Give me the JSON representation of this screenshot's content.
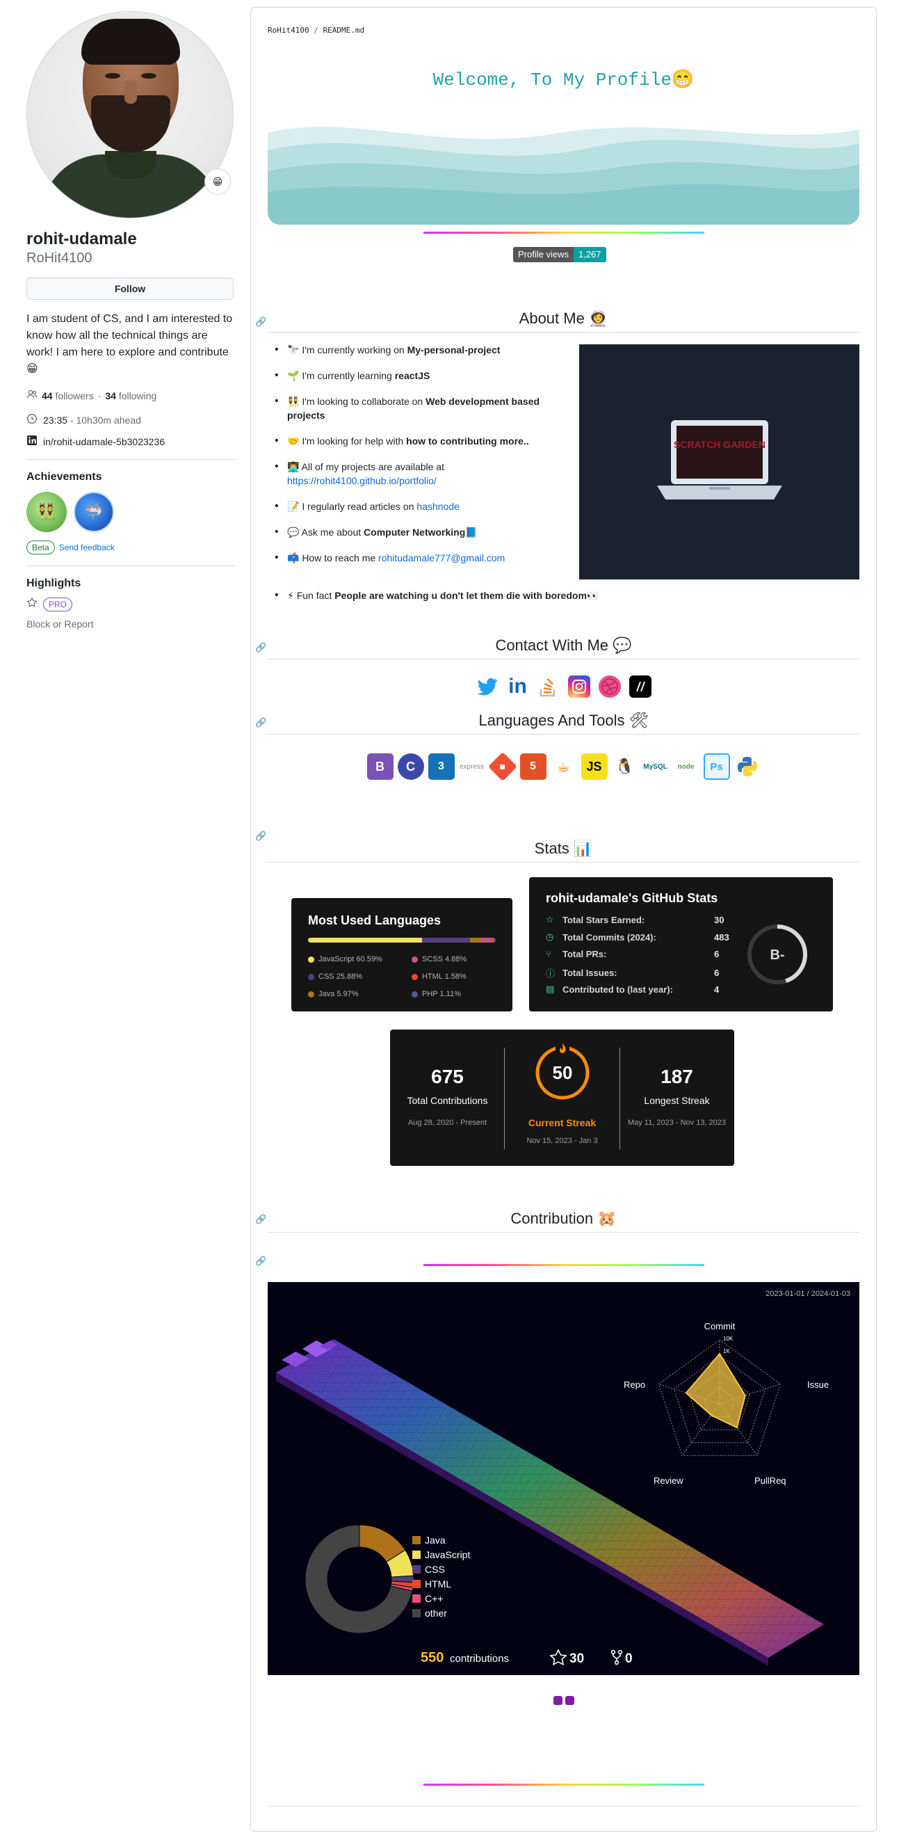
{
  "profile": {
    "fullname": "rohit-udamale",
    "login": "RoHit4100",
    "follow_label": "Follow",
    "bio": "I am student of CS, and I am interested to know how all the technical things are work! I am here to explore and contribute 😁",
    "followers_count": "44",
    "followers_label": "followers",
    "following_count": "34",
    "following_label": "following",
    "time": "23:35",
    "time_ahead": "- 10h30m ahead",
    "linkedin": "in/rohit-udamale-5b3023236"
  },
  "achievements": {
    "title": "Achievements",
    "beta": "Beta",
    "feedback": "Send feedback"
  },
  "highlights": {
    "title": "Highlights",
    "pro": "PRO",
    "block": "Block or Report"
  },
  "readme": {
    "path_user": "RoHit4100",
    "path_file": "README.md",
    "welcome": "Welcome, To My Profile😁",
    "views_label": "Profile views",
    "views_count": "1,267"
  },
  "about": {
    "title": "About Me 👩‍🚀",
    "items": [
      {
        "pre": "🔭 I'm currently working on ",
        "bold": "My-personal-project",
        "post": ""
      },
      {
        "pre": "🌱 I'm currently learning ",
        "bold": "reactJS",
        "post": ""
      },
      {
        "pre": "👯 I'm looking to collaborate on ",
        "bold": "Web development based projects",
        "post": ""
      },
      {
        "pre": "🤝 I'm looking for help with ",
        "bold": "how to contributing more..",
        "post": ""
      },
      {
        "pre": "👨‍💻 All of my projects are available at ",
        "link": "https://rohit4100.github.io/portfolio/",
        "post": ""
      },
      {
        "pre": "📝 I regularly read articles on ",
        "link": "hashnode",
        "post": ""
      },
      {
        "pre": "💬 Ask me about ",
        "bold": "Computer Networking",
        "post": "📘"
      },
      {
        "pre": "📫 How to reach me ",
        "link": "rohitudamale777@gmail.com",
        "post": ""
      }
    ],
    "fun_pre": "⚡ Fun fact ",
    "fun_bold": "People are watching u don't let them die with boredom👀",
    "scratch_text": "SCRATCH GARDEN"
  },
  "contact": {
    "title": "Contact With Me 💬"
  },
  "languages": {
    "title": "Languages And Tools 🛠"
  },
  "stats": {
    "title": "Stats 📊",
    "langs_title": "Most Used Languages",
    "langs": [
      {
        "name": "JavaScript 60.59%",
        "color": "#f1e05a",
        "pct": 60.59
      },
      {
        "name": "CSS 25.88%",
        "color": "#563d7c",
        "pct": 25.88
      },
      {
        "name": "Java 5.97%",
        "color": "#b07219",
        "pct": 5.97
      },
      {
        "name": "SCSS 4.88%",
        "color": "#c6538c",
        "pct": 4.88
      },
      {
        "name": "HTML 1.58%",
        "color": "#e34c26",
        "pct": 1.58
      },
      {
        "name": "PHP 1.11%",
        "color": "#4F5D95",
        "pct": 1.11
      }
    ],
    "gh_title": "rohit-udamale's GitHub Stats",
    "gh_rows": [
      {
        "icon": "☆",
        "label": "Total Stars Earned:",
        "value": "30"
      },
      {
        "icon": "◷",
        "label": "Total Commits (2024):",
        "value": "483"
      },
      {
        "icon": "⑂",
        "label": "Total PRs:",
        "value": "6"
      },
      {
        "icon": "ⓘ",
        "label": "Total Issues:",
        "value": "6"
      },
      {
        "icon": "▤",
        "label": "Contributed to (last year):",
        "value": "4"
      }
    ],
    "grade": "B-",
    "total_contrib": "675",
    "total_contrib_label": "Total Contributions",
    "total_contrib_range": "Aug 28, 2020 - Present",
    "current_streak": "50",
    "current_streak_label": "Current Streak",
    "current_streak_range": "Nov 15, 2023 - Jan 3",
    "longest_streak": "187",
    "longest_streak_label": "Longest Streak",
    "longest_streak_range": "May 11, 2023 - Nov 13, 2023"
  },
  "contribution": {
    "title": "Contribution 🐹",
    "range": "2023-01-01 / 2024-01-03",
    "radar_labels": [
      "Commit",
      "Issue",
      "PullReq",
      "Review",
      "Repo"
    ],
    "radar_ticks": [
      "10K",
      "1K"
    ],
    "legend": [
      {
        "name": "Java",
        "color": "#b07219"
      },
      {
        "name": "JavaScript",
        "color": "#f1e05a"
      },
      {
        "name": "CSS",
        "color": "#563d7c"
      },
      {
        "name": "HTML",
        "color": "#e34c26"
      },
      {
        "name": "C++",
        "color": "#f34b7d"
      },
      {
        "name": "other",
        "color": "#444444"
      }
    ],
    "contrib_count": "550",
    "contrib_label": "contributions",
    "stars": "30",
    "forks": "0"
  },
  "colors": {
    "accent_teal": "#1fa5a5",
    "link": "#0969da",
    "card_bg": "#151515"
  }
}
